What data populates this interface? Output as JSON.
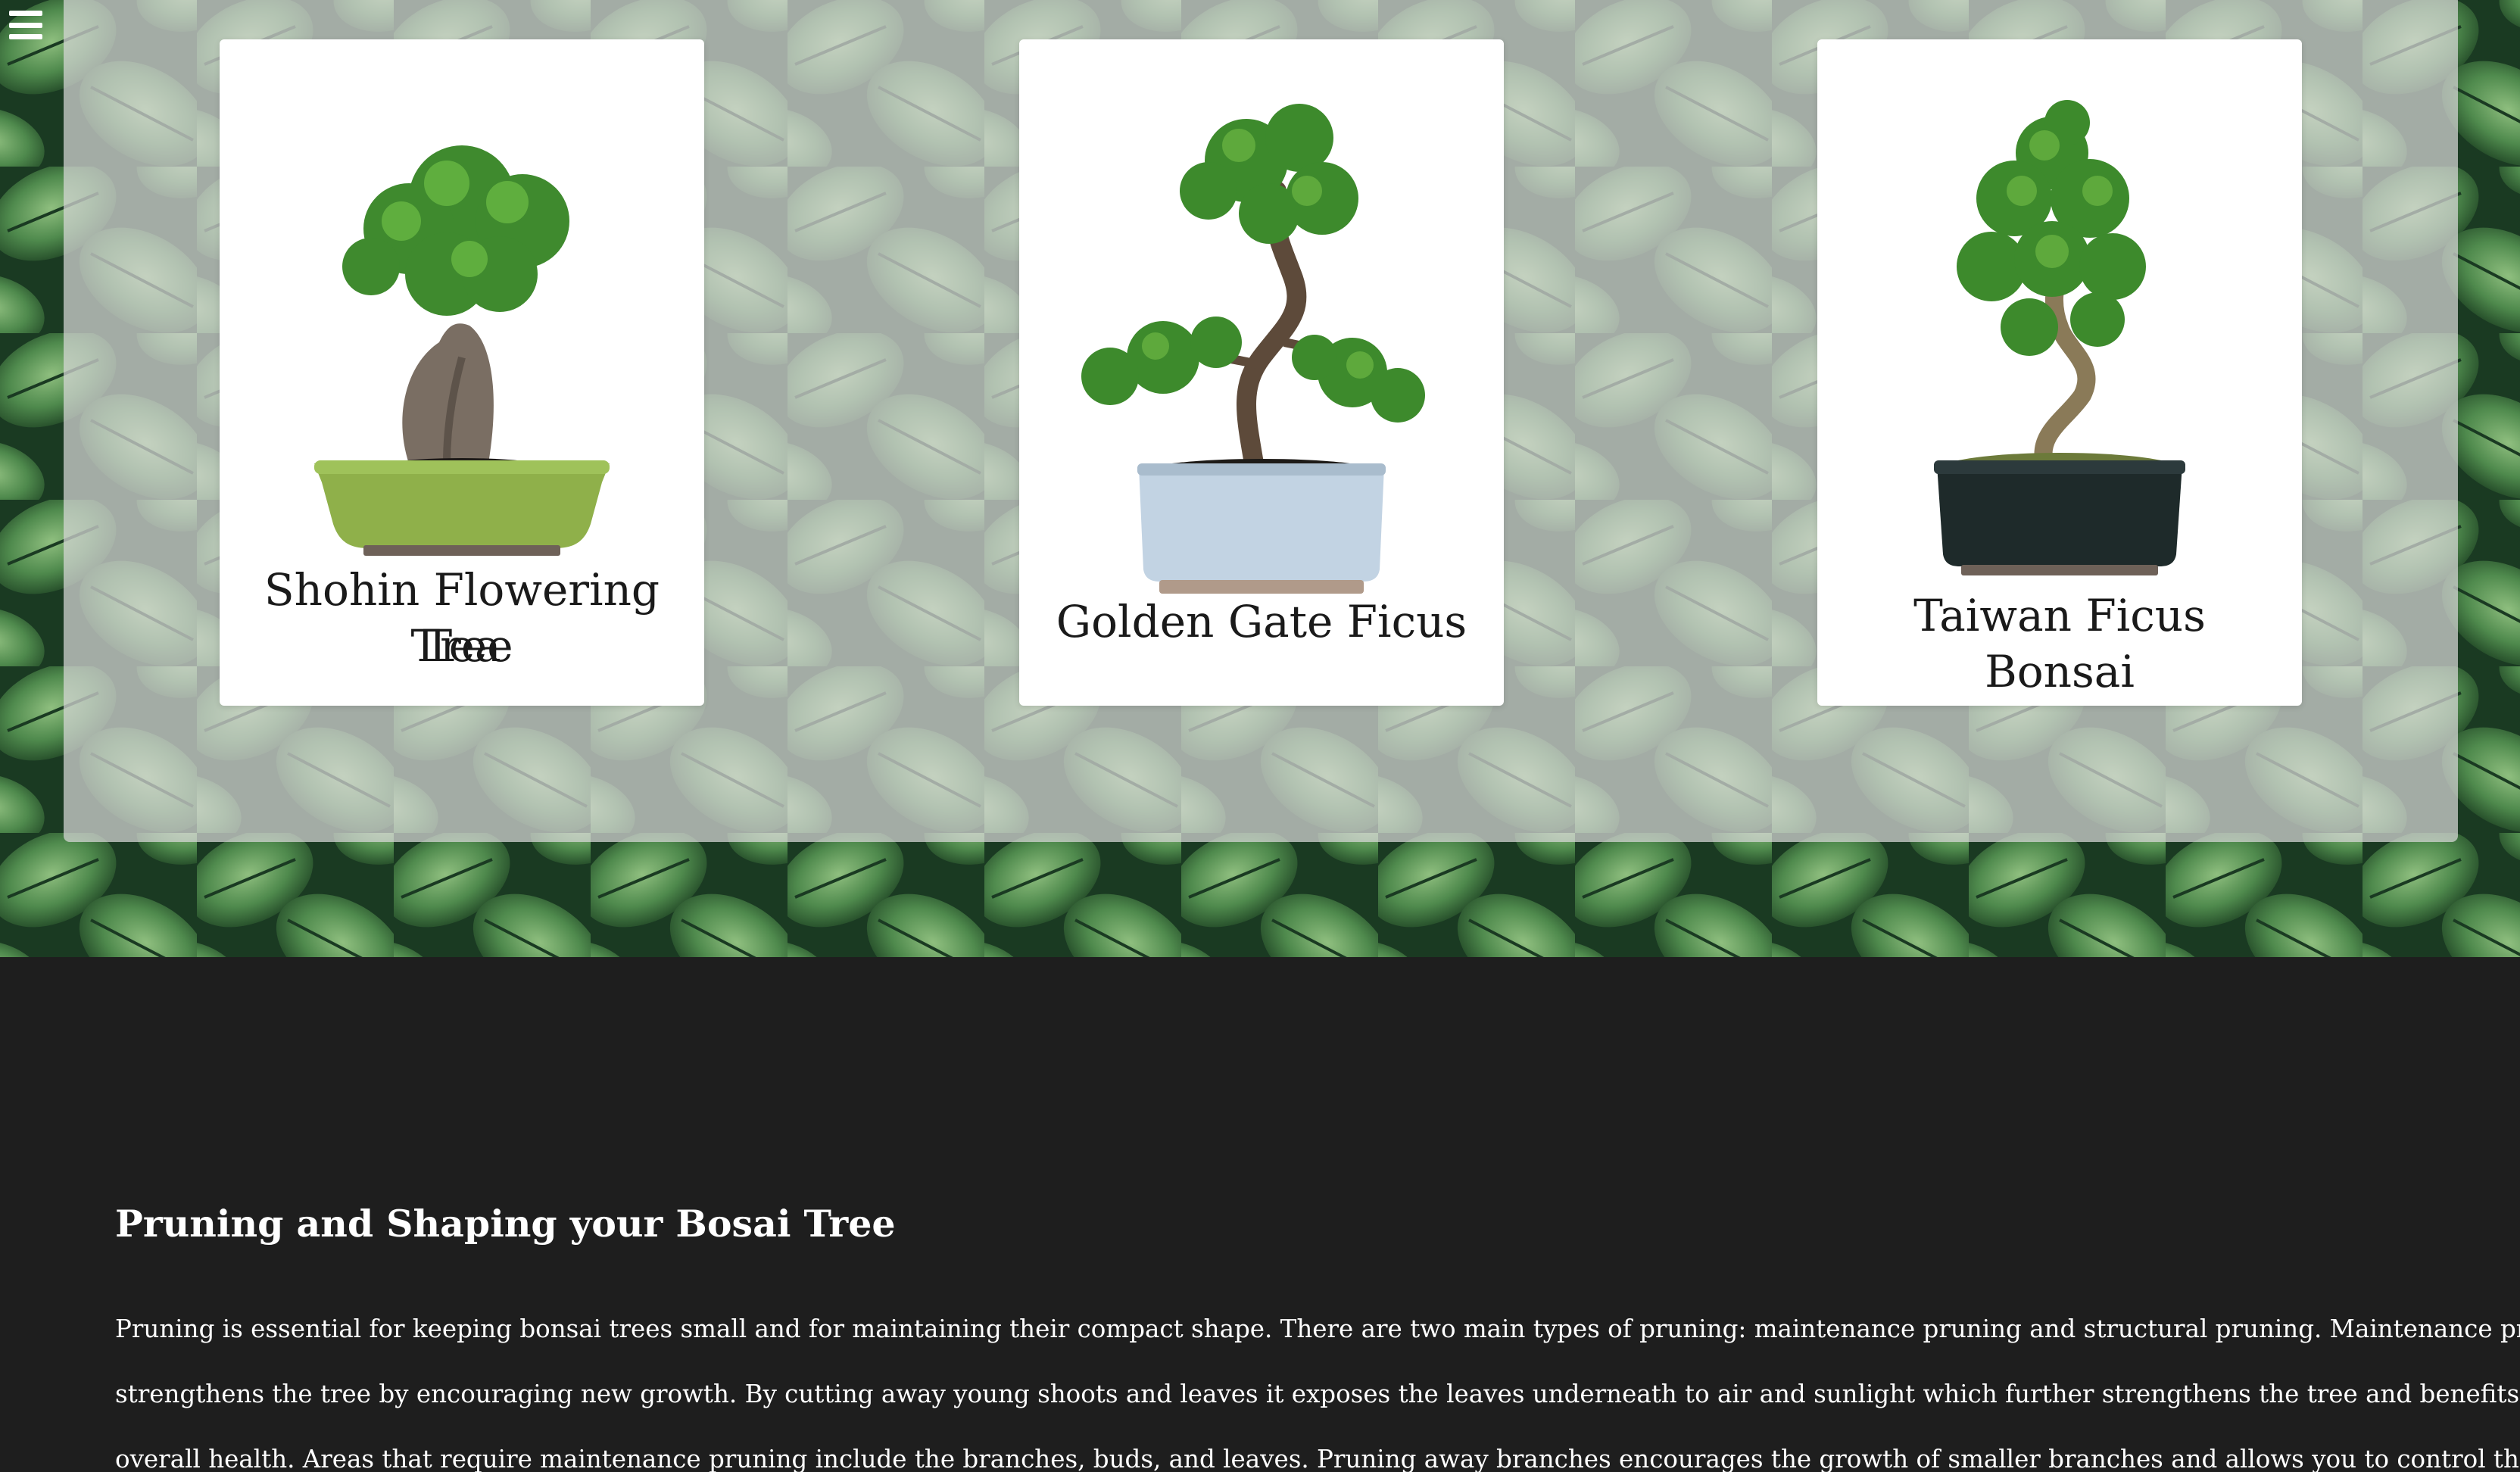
{
  "nav": {
    "menu_icon": "hamburger-menu-icon"
  },
  "gallery": {
    "cards": [
      {
        "title_line1": "Shohin Flowering Tea",
        "title_line2": "Tree",
        "pot_color": "#8fb04a"
      },
      {
        "title": "Golden Gate Ficus",
        "pot_color": "#c2d3e3"
      },
      {
        "title": "Taiwan Ficus Bonsai",
        "pot_color": "#1e2a2a"
      }
    ]
  },
  "article": {
    "heading": "Pruning and Shaping your Bosai Tree",
    "lines": [
      "Pruning is essential for keeping bonsai trees small and for maintaining their compact shape. There are two main types of pruning: maintenance pruning and structural pruning. Maintenance pruning",
      "strengthens the tree by encouraging new growth. By cutting away young shoots and leaves it exposes the leaves underneath to air and sunlight which further strengthens the tree and benefits its",
      "overall health. Areas that require maintenance pruning include the branches, buds, and leaves. Pruning away branches encourages the growth of smaller branches and allows you to control the shape"
    ]
  }
}
